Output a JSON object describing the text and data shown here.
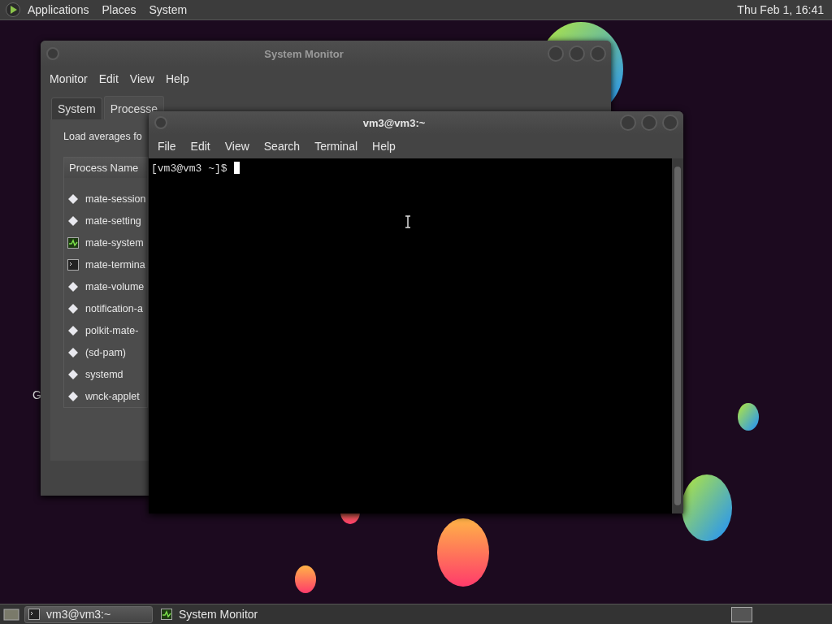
{
  "top_panel": {
    "menus": [
      "Applications",
      "Places",
      "System"
    ],
    "clock": "Thu Feb  1, 16:41"
  },
  "desktop": {
    "icon_label": "G"
  },
  "system_monitor": {
    "title": "System Monitor",
    "menus": [
      "Monitor",
      "Edit",
      "View",
      "Help"
    ],
    "tabs": [
      {
        "label": "System",
        "selected": false
      },
      {
        "label": "Processe",
        "selected": true
      }
    ],
    "load_text": "Load averages fo",
    "column": "Process Name",
    "processes": [
      {
        "name": "mate-session",
        "kind": "generic"
      },
      {
        "name": "mate-setting",
        "kind": "generic"
      },
      {
        "name": "mate-system",
        "kind": "monitor"
      },
      {
        "name": "mate-termina",
        "kind": "terminal"
      },
      {
        "name": "mate-volume",
        "kind": "generic"
      },
      {
        "name": "notification-a",
        "kind": "generic"
      },
      {
        "name": "polkit-mate-",
        "kind": "generic"
      },
      {
        "name": "(sd-pam)",
        "kind": "generic"
      },
      {
        "name": "systemd",
        "kind": "generic"
      },
      {
        "name": "wnck-applet",
        "kind": "generic"
      }
    ]
  },
  "terminal": {
    "title": "vm3@vm3:~",
    "menus": [
      "File",
      "Edit",
      "View",
      "Search",
      "Terminal",
      "Help"
    ],
    "prompt": "[vm3@vm3 ~]$"
  },
  "taskbar": {
    "tasks": [
      {
        "label": "vm3@vm3:~",
        "kind": "terminal",
        "selected": true
      },
      {
        "label": "System Monitor",
        "kind": "monitor",
        "selected": false
      }
    ]
  }
}
